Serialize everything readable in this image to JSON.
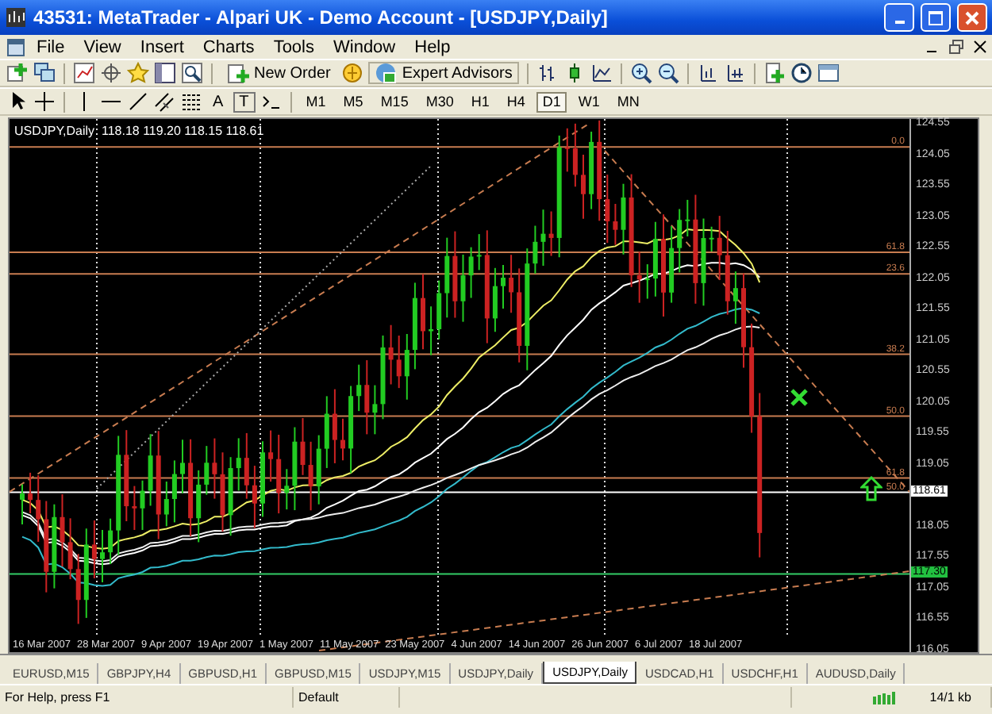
{
  "window": {
    "title": "43531: MetaTrader - Alpari UK - Demo Account - [USDJPY,Daily]"
  },
  "menu": [
    "File",
    "View",
    "Insert",
    "Charts",
    "Tools",
    "Window",
    "Help"
  ],
  "toolbar": {
    "new_order": "New Order",
    "expert_advisors": "Expert Advisors",
    "text_tools": [
      "A",
      "T"
    ],
    "timeframes": [
      {
        "label": "M1",
        "selected": false
      },
      {
        "label": "M5",
        "selected": false
      },
      {
        "label": "M15",
        "selected": false
      },
      {
        "label": "M30",
        "selected": false
      },
      {
        "label": "H1",
        "selected": false
      },
      {
        "label": "H4",
        "selected": false
      },
      {
        "label": "D1",
        "selected": true
      },
      {
        "label": "W1",
        "selected": false
      },
      {
        "label": "MN",
        "selected": false
      }
    ]
  },
  "chart": {
    "header": "USDJPY,Daily  118.18 119.20 118.15 118.61",
    "price_labels": [
      "124.55",
      "124.05",
      "123.55",
      "123.05",
      "122.55",
      "122.05",
      "121.55",
      "121.05",
      "120.55",
      "120.05",
      "119.55",
      "119.05",
      "118.05",
      "117.55",
      "117.05",
      "116.55",
      "116.05"
    ],
    "current_price": "118.61",
    "line_price": "117.30",
    "fib_labels": [
      "0.0",
      "61.8",
      "23.6",
      "38.2",
      "50.0",
      "61.8",
      "50.0"
    ],
    "dates": [
      "16 Mar 2007",
      "28 Mar 2007",
      "9 Apr 2007",
      "19 Apr 2007",
      "1 May 2007",
      "11 May 2007",
      "23 May 2007",
      "4 Jun 2007",
      "14 Jun 2007",
      "26 Jun 2007",
      "6 Jul 2007",
      "18 Jul 2007"
    ]
  },
  "tabs": [
    {
      "label": "EURUSD,M15",
      "selected": false
    },
    {
      "label": "GBPJPY,H4",
      "selected": false
    },
    {
      "label": "GBPUSD,H1",
      "selected": false
    },
    {
      "label": "GBPUSD,M15",
      "selected": false
    },
    {
      "label": "USDJPY,M15",
      "selected": false
    },
    {
      "label": "USDJPY,Daily",
      "selected": false
    },
    {
      "label": "USDJPY,Daily",
      "selected": true
    },
    {
      "label": "USDCAD,H1",
      "selected": false
    },
    {
      "label": "USDCHF,H1",
      "selected": false
    },
    {
      "label": "AUDUSD,Daily",
      "selected": false
    }
  ],
  "status_bar": {
    "help": "For Help, press F1",
    "profile": "Default",
    "traffic": "14/1 kb"
  }
}
